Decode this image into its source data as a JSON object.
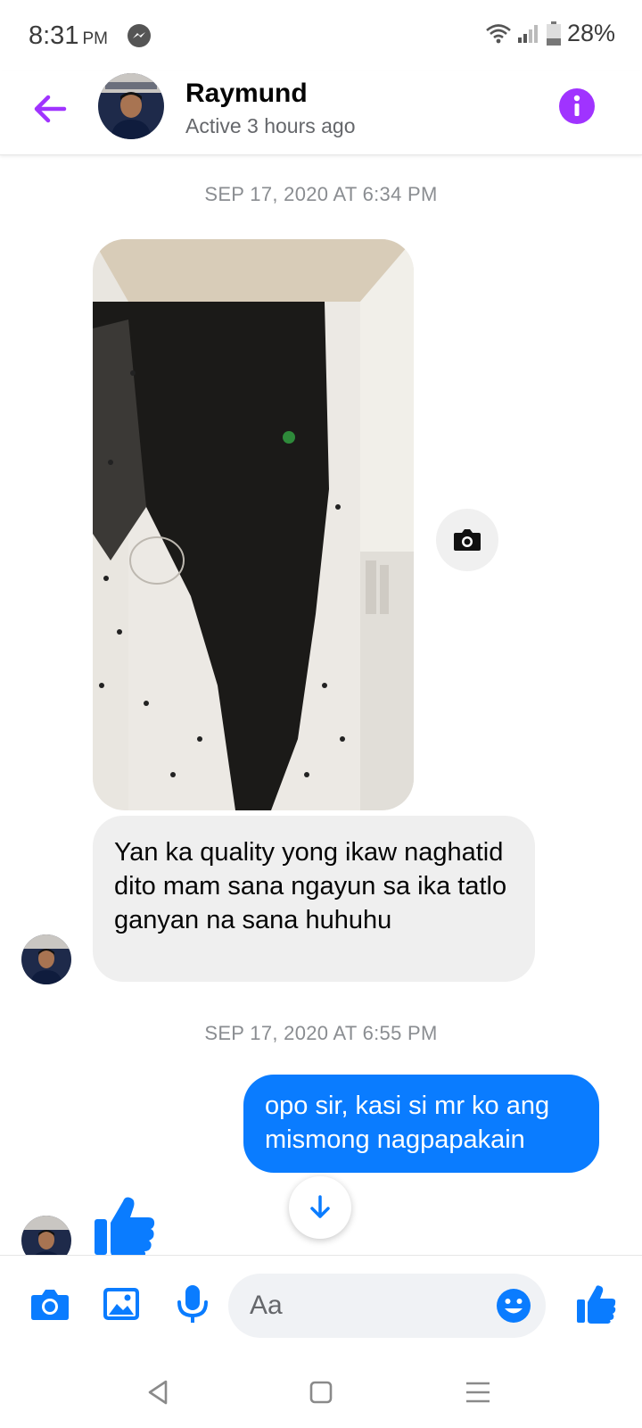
{
  "status_bar": {
    "time": "8:31",
    "ampm": "PM",
    "battery": "28%",
    "icons": [
      "messenger-icon",
      "wifi-icon",
      "signal-icon",
      "battery-icon"
    ]
  },
  "header": {
    "name": "Raymund",
    "status": "Active 3 hours ago",
    "accent_color": "#a033ff"
  },
  "thread": {
    "timestamp_1": "SEP 17, 2020 AT 6:34 PM",
    "incoming_message": "Yan ka quality yong ikaw naghatid dito mam sana ngayun sa ika tatlo ganyan na sana huhuhu",
    "timestamp_2": "SEP 17, 2020 AT 6:55 PM",
    "outgoing_message": "opo sir, kasi si mr ko ang mismong nagpapakain",
    "outgoing_color": "#0a7cff",
    "incoming_color": "#efefef"
  },
  "composer": {
    "placeholder": "Aa",
    "icons": [
      "camera-icon",
      "gallery-icon",
      "microphone-icon",
      "emoji-icon",
      "thumbs-up-icon"
    ],
    "icon_color": "#0a7cff"
  },
  "nav_bar": {
    "icons": [
      "back-triangle-icon",
      "home-square-icon",
      "menu-lines-icon"
    ]
  }
}
